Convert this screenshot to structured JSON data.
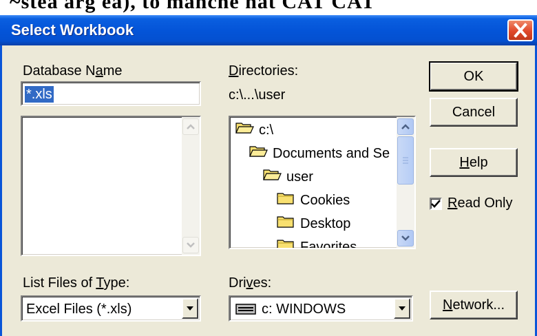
{
  "background_text": "~stea arg ea), to manche hat CAT CAT",
  "window": {
    "title": "Select Workbook"
  },
  "database_name": {
    "label_pre": "Database N",
    "label_mnemonic": "a",
    "label_post": "me",
    "value": "*.xls",
    "files": []
  },
  "directories": {
    "label_mnemonic": "D",
    "label_post": "irectories:",
    "current_path": "c:\\...\\user",
    "items": [
      {
        "name": "c:\\",
        "icon": "open-folder-icon",
        "indent": 0
      },
      {
        "name": "Documents and Se",
        "icon": "open-folder-icon",
        "indent": 1
      },
      {
        "name": "user",
        "icon": "open-folder-icon",
        "indent": 2
      },
      {
        "name": "Cookies",
        "icon": "folder-icon",
        "indent": 3
      },
      {
        "name": "Desktop",
        "icon": "folder-icon",
        "indent": 3
      },
      {
        "name": "Favorites",
        "icon": "folder-icon",
        "indent": 3
      }
    ]
  },
  "buttons": {
    "ok": "OK",
    "cancel": "Cancel",
    "help_mnemonic": "H",
    "help_rest": "elp",
    "network_mnemonic": "N",
    "network_rest": "etwork..."
  },
  "read_only": {
    "mnemonic": "R",
    "rest": "ead Only",
    "checked": true
  },
  "file_type": {
    "label_pre": "List Files of ",
    "label_mnemonic": "T",
    "label_post": "ype:",
    "value": "Excel Files (*.xls)"
  },
  "drives": {
    "label_pre": "Dri",
    "label_mnemonic": "v",
    "label_post": "es:",
    "value": "c: WINDOWS",
    "icon": "drive-icon"
  },
  "colors": {
    "titlebar": "#0454d8",
    "dialog_bg": "#ece9d8",
    "selection": "#316ac5",
    "folder": "#f8e070"
  }
}
